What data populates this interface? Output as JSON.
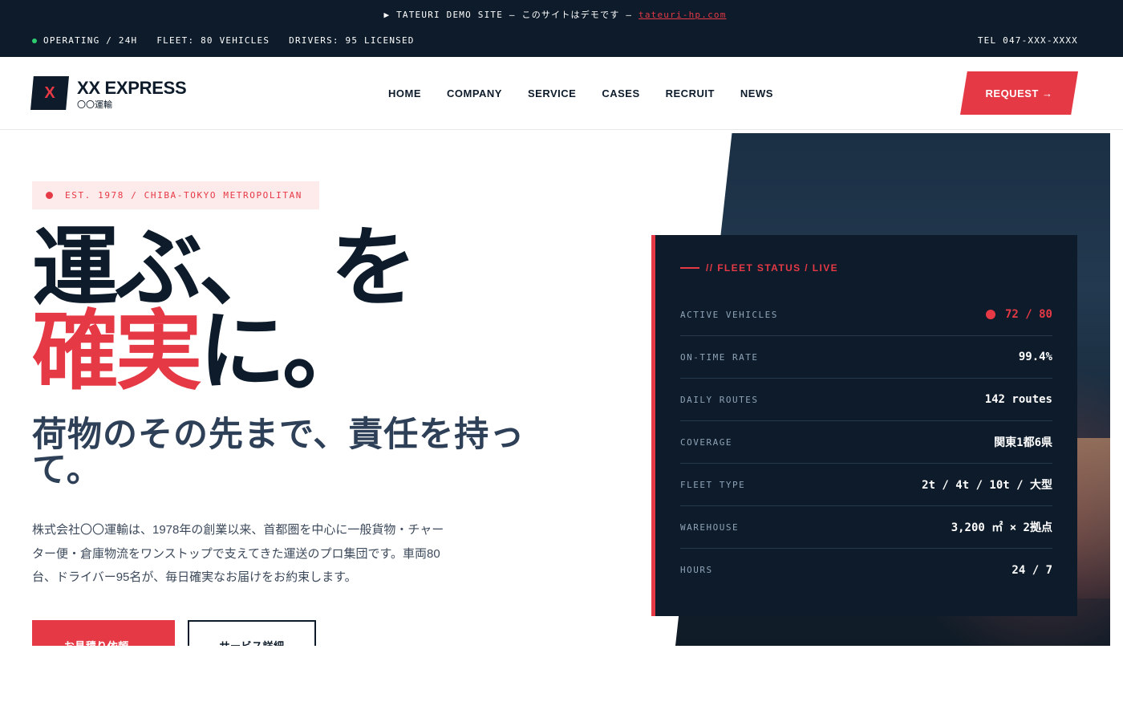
{
  "topbar": {
    "demo_prefix": "▶ TATEURI DEMO SITE — このサイトはデモです — ",
    "demo_link": "tateuri-hp.com",
    "status_operating": "OPERATING / 24H",
    "status_fleet": "FLEET: 80 VEHICLES",
    "status_drivers": "DRIVERS: 95 LICENSED",
    "tel": "TEL 047-XXX-XXXX",
    "status_color": "#2ecc71"
  },
  "header": {
    "logo_mark": "X",
    "logo_name": "XX EXPRESS",
    "logo_sub": "〇〇運輸",
    "nav": [
      "HOME",
      "COMPANY",
      "SERVICE",
      "CASES",
      "RECRUIT",
      "NEWS"
    ],
    "request_label": "REQUEST →"
  },
  "hero": {
    "badge": "EST. 1978 / CHIBA-TOKYO METROPOLITAN",
    "headline_1a": "運ぶ、",
    "headline_1b": "を",
    "headline_2_red": "確実",
    "headline_2_rest": "に。",
    "subhead": "荷物のその先まで、責任を持って。",
    "description": "株式会社〇〇運輸は、1978年の創業以来、首都圏を中心に一般貨物・チャーター便・倉庫物流をワンストップで支えてきた運送のプロ集団です。車両80台、ドライバー95名が、毎日確実なお届けをお約束します。",
    "primary_button": "お見積り依頼 →",
    "secondary_button": "サービス詳細"
  },
  "fleet_status": {
    "title": "// FLEET STATUS / LIVE",
    "rows": [
      {
        "label": "ACTIVE VEHICLES",
        "value": "72 / 80"
      },
      {
        "label": "ON-TIME RATE",
        "value": "99.4%"
      },
      {
        "label": "DAILY ROUTES",
        "value": "142 routes"
      },
      {
        "label": "COVERAGE",
        "value": "関東1都6県"
      },
      {
        "label": "FLEET TYPE",
        "value": "2t / 4t / 10t / 大型"
      },
      {
        "label": "WAREHOUSE",
        "value": "3,200 ㎡ × 2拠点"
      },
      {
        "label": "HOURS",
        "value": "24 / 7"
      }
    ]
  },
  "colors": {
    "navy": "#0d1b2a",
    "accent_red": "#e63946",
    "badge_bg": "#fdeaea"
  }
}
